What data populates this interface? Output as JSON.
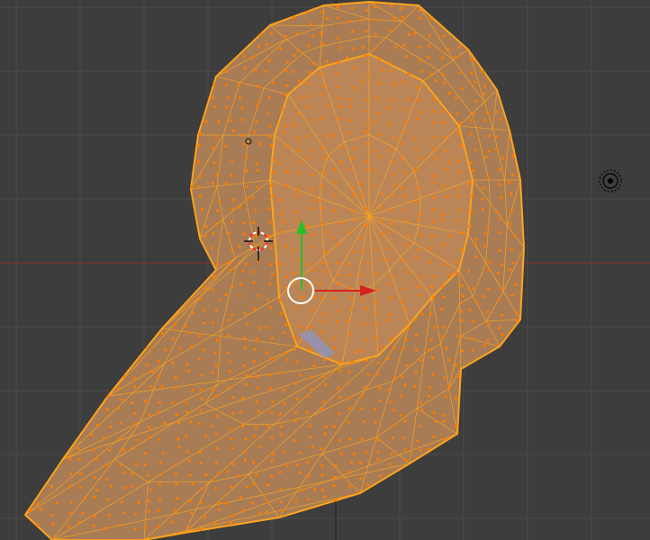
{
  "viewport": {
    "name": "3d-viewport",
    "mode": "edit-mode-face-select",
    "background_color": "#3d3d3d",
    "grid_color": "#4a4a4a",
    "x_axis_color": "#8b2c2c",
    "y_axis_color": "#1f1f1f"
  },
  "mesh": {
    "name": "ear-mesh",
    "fill_color": "#c08a5a",
    "edge_color": "#ffa31a",
    "face_dot_color": "#ff7a00",
    "vertex_color": "#ff9a1a",
    "fill_opacity": 0.82
  },
  "gizmo": {
    "name": "transform-manipulator",
    "x_arrow_color": "#d62020",
    "y_arrow_color": "#28c028",
    "center_ring_color": "#ffffff"
  },
  "cursor_3d": {
    "name": "3d-cursor",
    "ring_color_a": "#ff3030",
    "ring_color_b": "#ffffff"
  },
  "lamp": {
    "name": "lamp-object",
    "color": "#000000"
  },
  "icons": {
    "cursor": "crosshair-icon",
    "lamp": "lamp-icon",
    "gizmo": "move-gizmo-icon"
  }
}
